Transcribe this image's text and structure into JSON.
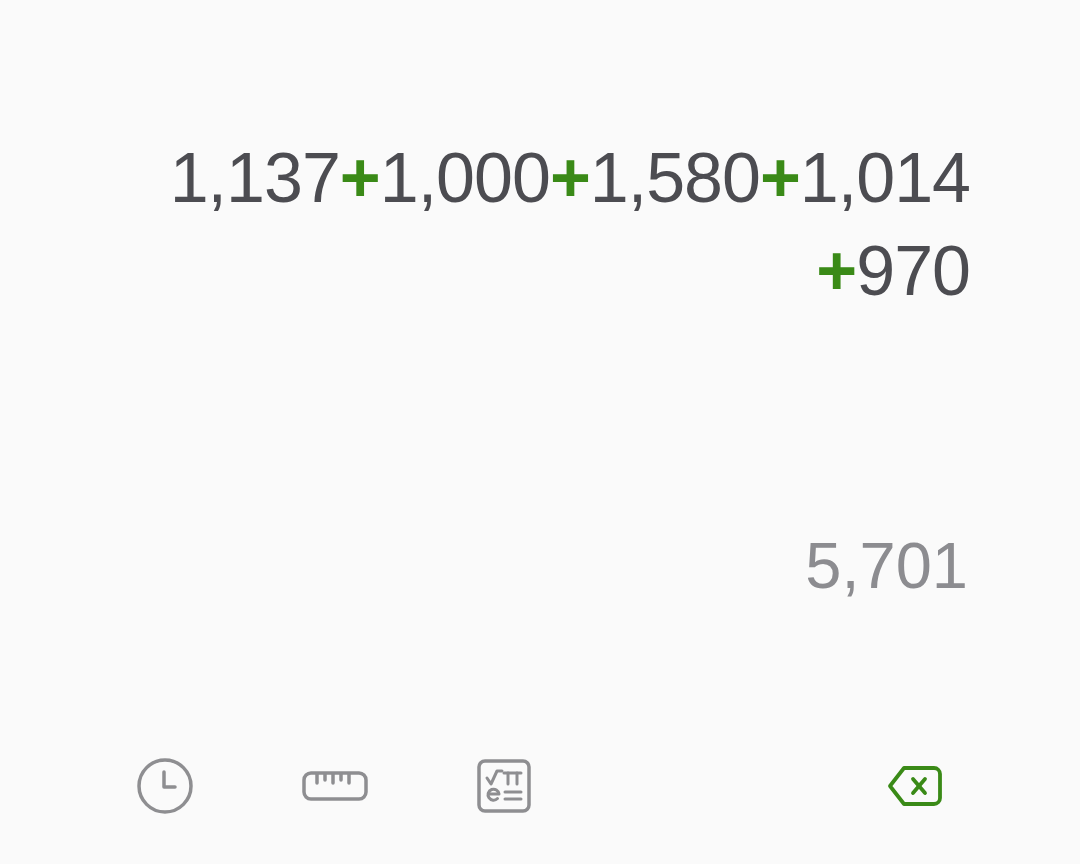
{
  "expression": {
    "lines": [
      [
        {
          "kind": "number",
          "text": "1,137"
        },
        {
          "kind": "operator",
          "text": "+"
        },
        {
          "kind": "number",
          "text": "1,000"
        },
        {
          "kind": "operator",
          "text": "+"
        },
        {
          "kind": "number",
          "text": "1,580"
        },
        {
          "kind": "operator",
          "text": "+"
        },
        {
          "kind": "number",
          "text": "1,014"
        }
      ],
      [
        {
          "kind": "operator",
          "text": "+"
        },
        {
          "kind": "number",
          "text": "970"
        }
      ]
    ]
  },
  "result": "5,701"
}
